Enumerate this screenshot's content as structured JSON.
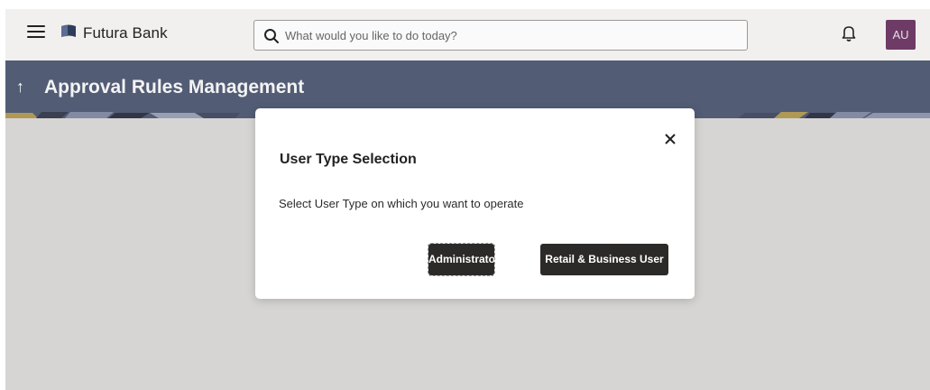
{
  "header": {
    "brand": "Futura Bank",
    "search_placeholder": "What would you like to do today?",
    "avatar_initials": "AU"
  },
  "page": {
    "title": "Approval Rules Management",
    "back_glyph": "↑"
  },
  "modal": {
    "title": "User Type Selection",
    "message": "Select User Type on which you want to operate",
    "buttons": {
      "administrator": "Administrator",
      "retail_business": "Retail & Business User"
    },
    "close_glyph": "✕"
  },
  "colors": {
    "header_bg": "#f1f0ee",
    "title_band": "#4a5675",
    "avatar_bg": "#6e3b66",
    "button_dark": "#2c2a29",
    "main_bg": "#d6d5d3"
  },
  "icons": [
    "hamburger-menu-icon",
    "bank-logo-icon",
    "search-icon",
    "bell-icon",
    "close-icon",
    "back-arrow-icon"
  ]
}
